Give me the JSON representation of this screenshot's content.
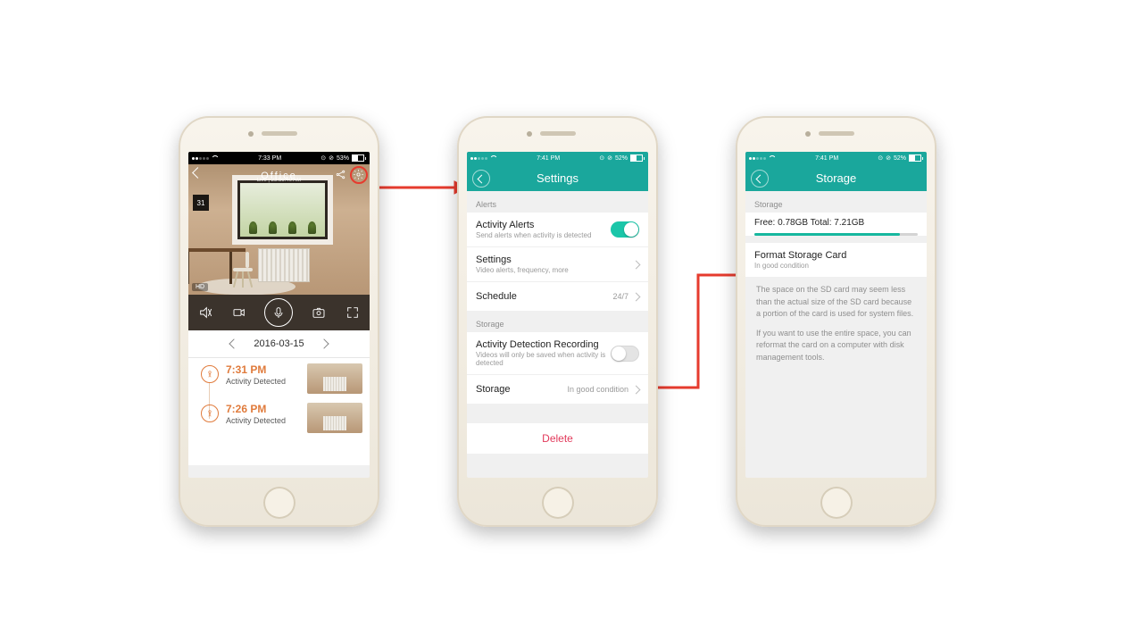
{
  "statusbars": {
    "p1": {
      "time": "7:33 PM",
      "battery": "53%"
    },
    "p2": {
      "time": "7:41 PM",
      "battery": "52%"
    },
    "p3": {
      "time": "7:41 PM",
      "battery": "52%"
    }
  },
  "phone1": {
    "title": "Office",
    "subtitle": "Live | 23:56:40 AM",
    "live_badge": "HD",
    "calendar_day": "31",
    "date": "2016-03-15",
    "events": [
      {
        "time": "7:31 PM",
        "label": "Activity Detected"
      },
      {
        "time": "7:26 PM",
        "label": "Activity Detected"
      }
    ]
  },
  "phone2": {
    "nav_title": "Settings",
    "section_alerts": "Alerts",
    "activity_alerts": {
      "title": "Activity Alerts",
      "sub": "Send alerts when activity is detected",
      "on": true
    },
    "settings": {
      "title": "Settings",
      "sub": "Video alerts, frequency, more"
    },
    "schedule": {
      "title": "Schedule",
      "value": "24/7"
    },
    "section_storage": "Storage",
    "adr": {
      "title": "Activity Detection Recording",
      "sub": "Videos will only be saved when activity is detected",
      "on": false
    },
    "storage": {
      "title": "Storage",
      "value": "In good condition"
    },
    "delete": "Delete"
  },
  "phone3": {
    "nav_title": "Storage",
    "section_storage": "Storage",
    "free_line": "Free: 0.78GB Total: 7.21GB",
    "fill_pct": 89,
    "format": {
      "title": "Format Storage Card",
      "sub": "In good condition"
    },
    "info1": "The space on the SD card may seem less than the actual size of the SD card because a portion of the card is used for system files.",
    "info2": "If you want to use the entire space, you can reformat the card on a computer with disk management tools."
  }
}
